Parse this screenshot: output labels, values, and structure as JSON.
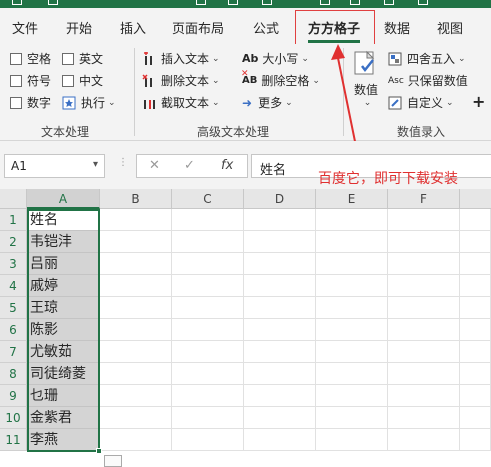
{
  "colors": {
    "accent": "#217346",
    "annotation": "#e03030",
    "selection": "#d4d4d4"
  },
  "tabs": [
    "文件",
    "开始",
    "插入",
    "页面布局",
    "公式",
    "方方格子",
    "数据",
    "视图"
  ],
  "active_tab": "方方格子",
  "ribbon": {
    "text_group": {
      "label": "文本处理",
      "checkboxes": [
        "空格",
        "英文",
        "符号",
        "中文",
        "数字"
      ],
      "execute": "执行"
    },
    "advanced_group": {
      "label": "高级文本处理",
      "insert_text": "插入文本",
      "delete_text": "删除文本",
      "extract_text": "截取文本",
      "case": "大小写",
      "case_icon_text": "Ab",
      "delete_space": "删除空格",
      "delete_space_icon_text": "AB",
      "more": "更多"
    },
    "number_group": {
      "label": "数值录入",
      "numbers": "数值",
      "round": "四舍五入",
      "keep_values": "只保留数值",
      "keep_values_icon_text": "Asc",
      "custom": "自定义",
      "plus": "+"
    }
  },
  "formula_bar": {
    "namebox": "A1",
    "cancel_glyph": "✕",
    "enter_glyph": "✓",
    "fx_glyph": "fx",
    "formula": "姓名"
  },
  "annotation": "百度它，即可下载安装",
  "columns": [
    "A",
    "B",
    "C",
    "D",
    "E",
    "F"
  ],
  "rows": [
    "1",
    "2",
    "3",
    "4",
    "5",
    "6",
    "7",
    "8",
    "9",
    "10",
    "11"
  ],
  "column_a": [
    "姓名",
    "韦铠沣",
    "吕丽",
    "戚婷",
    "王琼",
    "陈影",
    "尤敏茹",
    "司徒绮菱",
    "乜珊",
    "金紫君",
    "李燕"
  ]
}
